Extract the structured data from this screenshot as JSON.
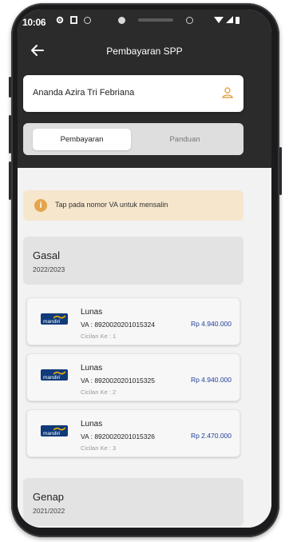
{
  "status_bar": {
    "time": "10:06"
  },
  "app_bar": {
    "title": "Pembayaran SPP"
  },
  "student": {
    "name": "Ananda Azira Tri Febriana"
  },
  "tabs": [
    {
      "label": "Pembayaran",
      "active": true
    },
    {
      "label": "Panduan",
      "active": false
    }
  ],
  "alert": {
    "icon": "i",
    "text": "Tap pada nomor VA untuk mensalin"
  },
  "semesters": [
    {
      "title": "Gasal",
      "year": "2022/2023",
      "payments": [
        {
          "bank": "mandiri",
          "status": "Lunas",
          "va": "VA : 8920020201015324",
          "cicilan": "Cicilan Ke : 1",
          "amount": "Rp 4.940.000"
        },
        {
          "bank": "mandiri",
          "status": "Lunas",
          "va": "VA : 8920020201015325",
          "cicilan": "Cicilan Ke : 2",
          "amount": "Rp 4.940.000"
        },
        {
          "bank": "mandiri",
          "status": "Lunas",
          "va": "VA : 8920020201015326",
          "cicilan": "Cicilan Ke : 3",
          "amount": "Rp 2.470.000"
        }
      ]
    },
    {
      "title": "Genap",
      "year": "2021/2022",
      "payments": []
    }
  ],
  "colors": {
    "header": "#2b2b2b",
    "alert_bg": "#f6e6cc",
    "alert_icon": "#e3a64c",
    "amount": "#1e3f99",
    "bank": "#103a7a"
  }
}
